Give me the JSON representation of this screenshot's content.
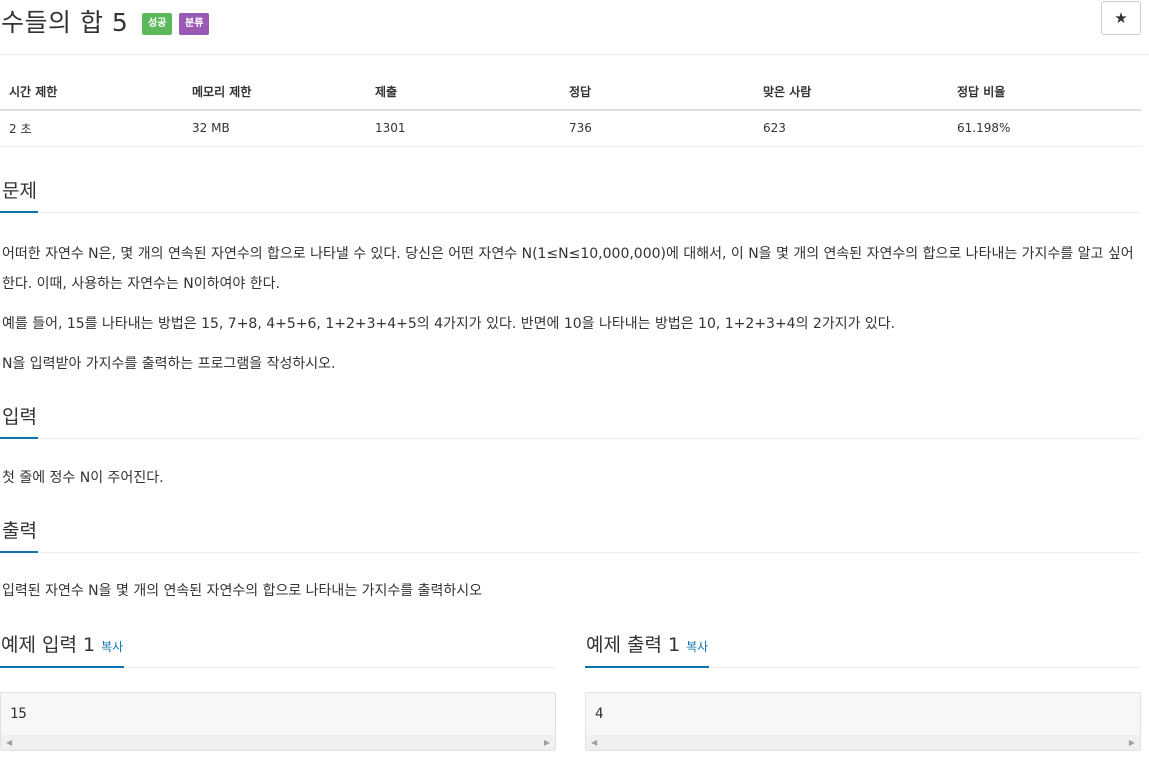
{
  "problem": {
    "title": "수들의 합 5",
    "badges": {
      "success": "성공",
      "category": "분류"
    },
    "star_icon": "★"
  },
  "info_table": {
    "headers": [
      "시간 제한",
      "메모리 제한",
      "제출",
      "정답",
      "맞은 사람",
      "정답 비율"
    ],
    "row": [
      "2 초",
      "32 MB",
      "1301",
      "736",
      "623",
      "61.198%"
    ]
  },
  "sections": {
    "problem_heading": "문제",
    "problem_paragraphs": [
      "어떠한 자연수 N은, 몇 개의 연속된 자연수의 합으로 나타낼 수 있다. 당신은 어떤 자연수 N(1≤N≤10,000,000)에 대해서, 이 N을 몇 개의 연속된 자연수의 합으로 나타내는 가지수를 알고 싶어한다. 이때, 사용하는 자연수는 N이하여야 한다.",
      "예를 들어, 15를 나타내는 방법은 15, 7+8, 4+5+6, 1+2+3+4+5의 4가지가 있다. 반면에 10을 나타내는 방법은 10, 1+2+3+4의 2가지가 있다.",
      "N을 입력받아 가지수를 출력하는 프로그램을 작성하시오."
    ],
    "input_heading": "입력",
    "input_text": "첫 줄에 정수 N이 주어진다.",
    "output_heading": "출력",
    "output_text": "입력된 자연수 N을 몇 개의 연속된 자연수의 합으로 나타내는 가지수를 출력하시오"
  },
  "samples": {
    "input_heading": "예제 입력 1",
    "output_heading": "예제 출력 1",
    "copy_label": "복사",
    "input_value": "15",
    "output_value": "4"
  },
  "colors": {
    "accent": "#0a75ad",
    "success_badge": "#5cb85c",
    "category_badge": "#9b59b6"
  }
}
